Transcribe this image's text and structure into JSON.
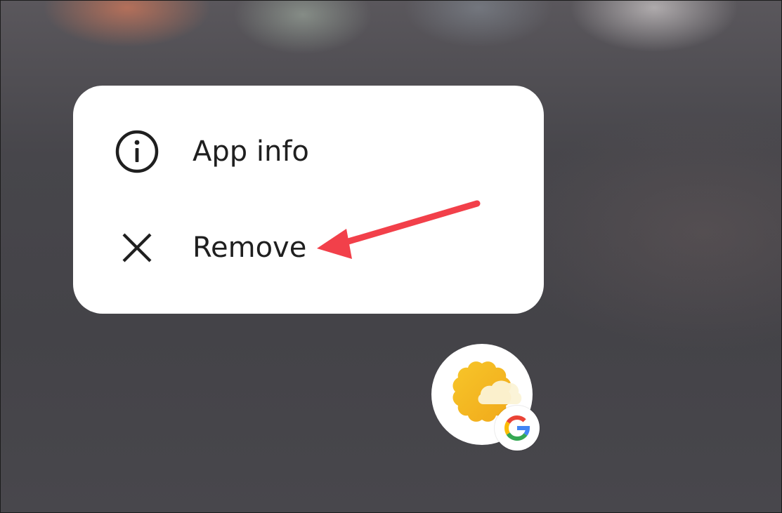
{
  "context_menu": {
    "items": [
      {
        "label": "App info",
        "icon": "info-icon"
      },
      {
        "label": "Remove",
        "icon": "close-icon"
      }
    ]
  },
  "annotation": {
    "arrow_color": "#f2404a"
  },
  "app": {
    "icon": "weather-sun-cloud-icon",
    "badge_icon": "google-g-icon"
  }
}
